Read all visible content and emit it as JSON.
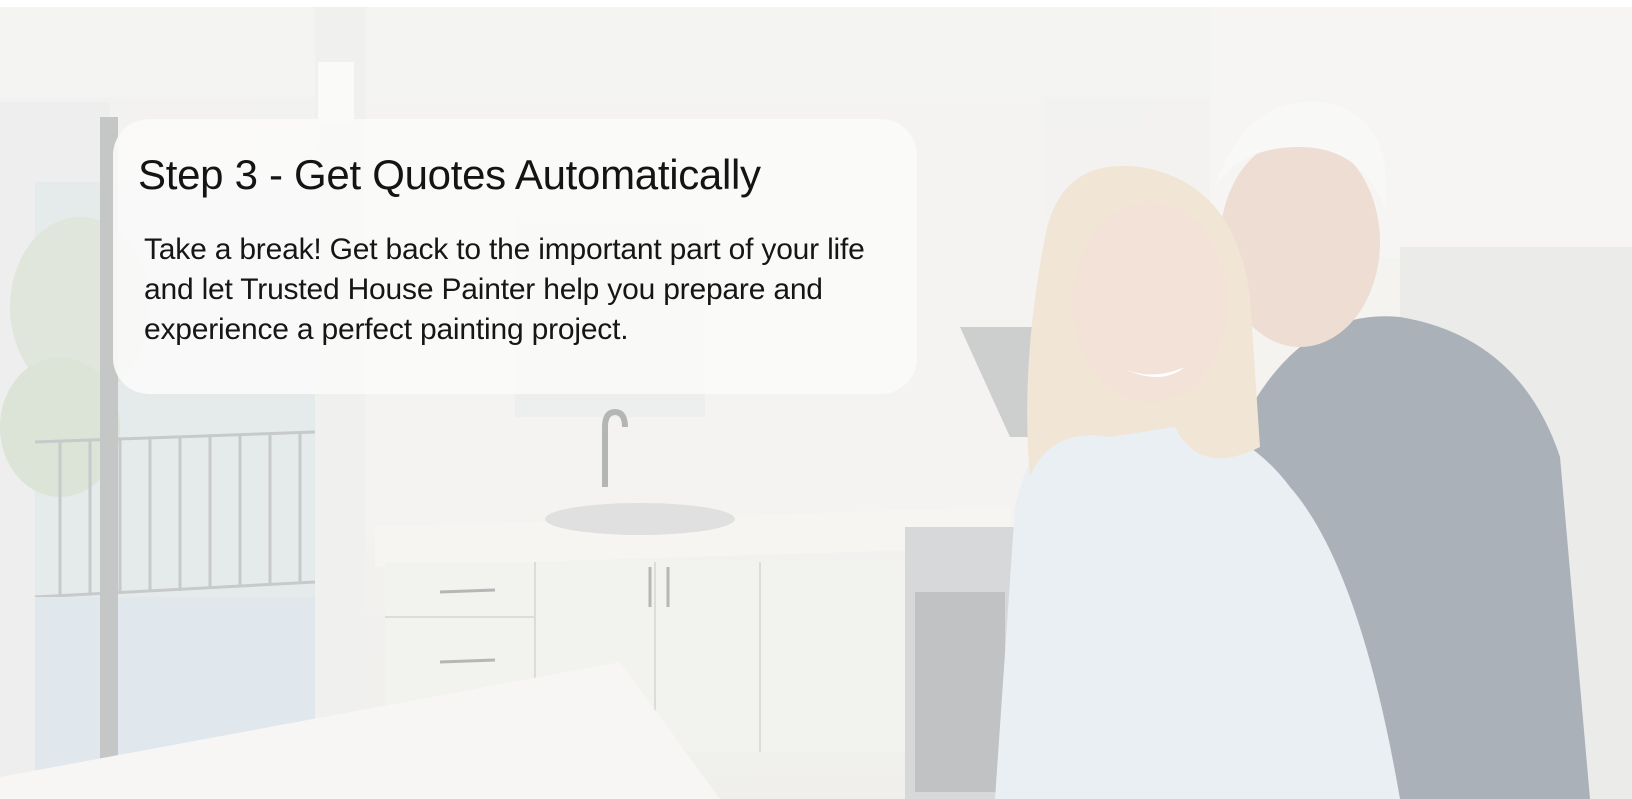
{
  "hero": {
    "image_alt_icon": "kitchen-couple-photo",
    "card": {
      "title": "Step 3 - Get Quotes Automatically",
      "body": "Take a break! Get back to the important part of your life and let Trusted House Painter help you prepare and experience a perfect painting project."
    }
  }
}
